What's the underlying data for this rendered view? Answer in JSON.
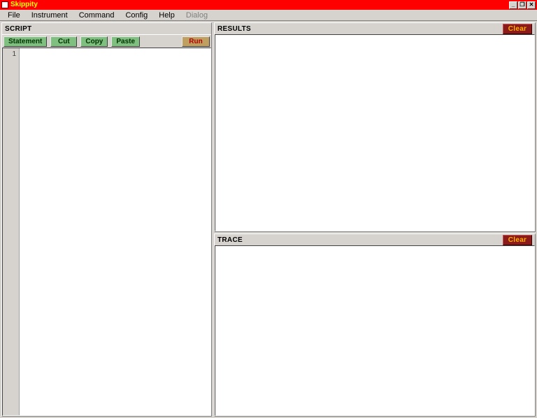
{
  "window": {
    "title": "Skippity",
    "buttons": {
      "min": "_",
      "max": "❐",
      "close": "✕"
    }
  },
  "menu": {
    "file": "File",
    "instrument": "Instrument",
    "command": "Command",
    "config": "Config",
    "help": "Help",
    "dialog": "Dialog"
  },
  "script": {
    "title": "SCRIPT",
    "toolbar": {
      "statement": "Statement",
      "cut": "Cut",
      "copy": "Copy",
      "paste": "Paste",
      "run": "Run"
    },
    "first_line_no": "1"
  },
  "results": {
    "title": "RESULTS",
    "clear": "Clear"
  },
  "trace": {
    "title": "TRACE",
    "clear": "Clear"
  }
}
